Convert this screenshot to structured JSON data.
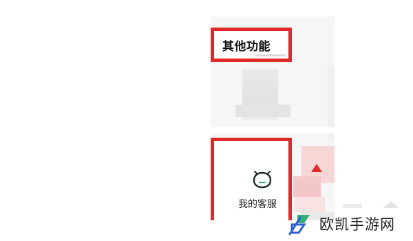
{
  "section": {
    "title": "其他功能"
  },
  "service": {
    "label": "我的客服",
    "icon": "customer-service-robot-icon"
  },
  "watermark": {
    "text": "欧凯手游网",
    "logo": "ok-logo-icon"
  },
  "colors": {
    "highlight_red": "#e02a2a",
    "logo_green": "#33b07a",
    "logo_blue": "#2f5fd0"
  }
}
